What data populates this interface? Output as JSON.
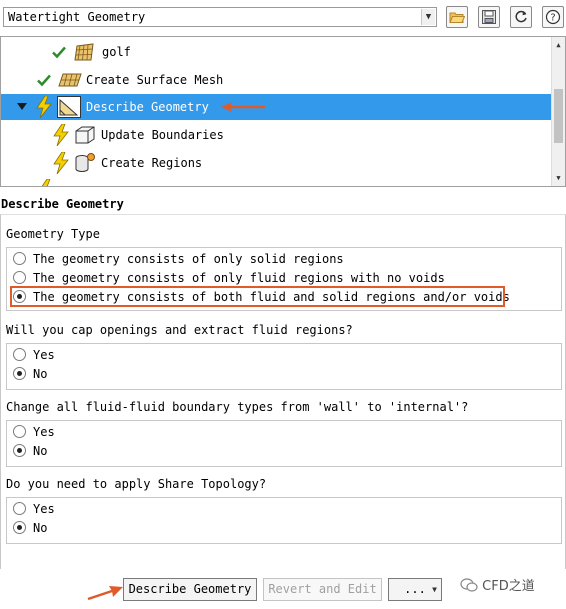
{
  "toolbar": {
    "workflow_value": "Watertight Geometry",
    "icons": [
      "folder-open-icon",
      "save-icon",
      "refresh-icon",
      "help-icon"
    ],
    "help_glyph": "?"
  },
  "tree": {
    "items": [
      {
        "label": "golf",
        "icons": [
          "check-icon",
          "surface-mesh-icon"
        ],
        "state": "done"
      },
      {
        "label": "Create Surface Mesh",
        "icons": [
          "check-icon",
          "surface-mesh-icon"
        ],
        "state": "done"
      },
      {
        "label": "Describe Geometry",
        "icons": [
          "lightning-icon",
          "geometry-icon"
        ],
        "state": "selected"
      },
      {
        "label": "Update Boundaries",
        "icons": [
          "lightning-icon",
          "boundary-icon"
        ],
        "state": "pending"
      },
      {
        "label": "Create Regions",
        "icons": [
          "lightning-icon",
          "regions-icon"
        ],
        "state": "pending"
      }
    ]
  },
  "panel": {
    "title": "Describe Geometry",
    "geometry_type": {
      "label": "Geometry Type",
      "options": [
        "The geometry consists of only solid regions",
        "The geometry consists of only fluid regions with no voids",
        "The geometry consists of both fluid and solid regions and/or voids"
      ],
      "selected": 2
    },
    "cap_openings": {
      "label": "Will you cap openings and extract fluid regions?",
      "options": [
        "Yes",
        "No"
      ],
      "selected": 1
    },
    "change_boundary": {
      "label": "Change all fluid-fluid boundary types from 'wall' to 'internal'?",
      "options": [
        "Yes",
        "No"
      ],
      "selected": 1
    },
    "share_topology": {
      "label": "Do you need to apply Share Topology?",
      "options": [
        "Yes",
        "No"
      ],
      "selected": 1
    }
  },
  "buttons": {
    "describe": "Describe Geometry",
    "revert": "Revert and Edit",
    "more": "..."
  },
  "watermark": "CFD之道",
  "colors": {
    "selection": "#3399ea",
    "annotation": "#e05a2a",
    "check": "#2e8b2e",
    "lightning": "#f5d000"
  }
}
